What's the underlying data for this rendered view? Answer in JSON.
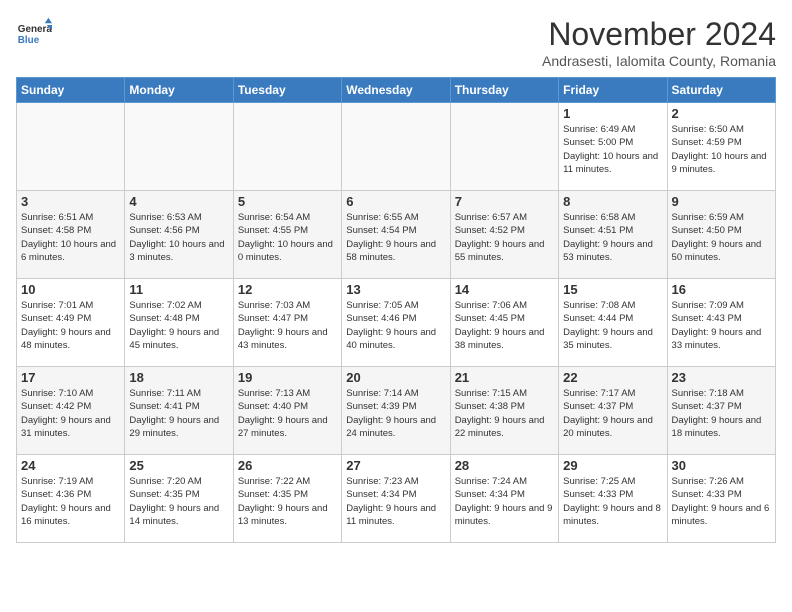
{
  "header": {
    "logo_line1": "General",
    "logo_line2": "Blue",
    "month_title": "November 2024",
    "location": "Andrasesti, Ialomita County, Romania"
  },
  "days_of_week": [
    "Sunday",
    "Monday",
    "Tuesday",
    "Wednesday",
    "Thursday",
    "Friday",
    "Saturday"
  ],
  "weeks": [
    [
      {
        "day": "",
        "info": "",
        "empty": true
      },
      {
        "day": "",
        "info": "",
        "empty": true
      },
      {
        "day": "",
        "info": "",
        "empty": true
      },
      {
        "day": "",
        "info": "",
        "empty": true
      },
      {
        "day": "",
        "info": "",
        "empty": true
      },
      {
        "day": "1",
        "info": "Sunrise: 6:49 AM\nSunset: 5:00 PM\nDaylight: 10 hours and 11 minutes."
      },
      {
        "day": "2",
        "info": "Sunrise: 6:50 AM\nSunset: 4:59 PM\nDaylight: 10 hours and 9 minutes."
      }
    ],
    [
      {
        "day": "3",
        "info": "Sunrise: 6:51 AM\nSunset: 4:58 PM\nDaylight: 10 hours and 6 minutes."
      },
      {
        "day": "4",
        "info": "Sunrise: 6:53 AM\nSunset: 4:56 PM\nDaylight: 10 hours and 3 minutes."
      },
      {
        "day": "5",
        "info": "Sunrise: 6:54 AM\nSunset: 4:55 PM\nDaylight: 10 hours and 0 minutes."
      },
      {
        "day": "6",
        "info": "Sunrise: 6:55 AM\nSunset: 4:54 PM\nDaylight: 9 hours and 58 minutes."
      },
      {
        "day": "7",
        "info": "Sunrise: 6:57 AM\nSunset: 4:52 PM\nDaylight: 9 hours and 55 minutes."
      },
      {
        "day": "8",
        "info": "Sunrise: 6:58 AM\nSunset: 4:51 PM\nDaylight: 9 hours and 53 minutes."
      },
      {
        "day": "9",
        "info": "Sunrise: 6:59 AM\nSunset: 4:50 PM\nDaylight: 9 hours and 50 minutes."
      }
    ],
    [
      {
        "day": "10",
        "info": "Sunrise: 7:01 AM\nSunset: 4:49 PM\nDaylight: 9 hours and 48 minutes."
      },
      {
        "day": "11",
        "info": "Sunrise: 7:02 AM\nSunset: 4:48 PM\nDaylight: 9 hours and 45 minutes."
      },
      {
        "day": "12",
        "info": "Sunrise: 7:03 AM\nSunset: 4:47 PM\nDaylight: 9 hours and 43 minutes."
      },
      {
        "day": "13",
        "info": "Sunrise: 7:05 AM\nSunset: 4:46 PM\nDaylight: 9 hours and 40 minutes."
      },
      {
        "day": "14",
        "info": "Sunrise: 7:06 AM\nSunset: 4:45 PM\nDaylight: 9 hours and 38 minutes."
      },
      {
        "day": "15",
        "info": "Sunrise: 7:08 AM\nSunset: 4:44 PM\nDaylight: 9 hours and 35 minutes."
      },
      {
        "day": "16",
        "info": "Sunrise: 7:09 AM\nSunset: 4:43 PM\nDaylight: 9 hours and 33 minutes."
      }
    ],
    [
      {
        "day": "17",
        "info": "Sunrise: 7:10 AM\nSunset: 4:42 PM\nDaylight: 9 hours and 31 minutes."
      },
      {
        "day": "18",
        "info": "Sunrise: 7:11 AM\nSunset: 4:41 PM\nDaylight: 9 hours and 29 minutes."
      },
      {
        "day": "19",
        "info": "Sunrise: 7:13 AM\nSunset: 4:40 PM\nDaylight: 9 hours and 27 minutes."
      },
      {
        "day": "20",
        "info": "Sunrise: 7:14 AM\nSunset: 4:39 PM\nDaylight: 9 hours and 24 minutes."
      },
      {
        "day": "21",
        "info": "Sunrise: 7:15 AM\nSunset: 4:38 PM\nDaylight: 9 hours and 22 minutes."
      },
      {
        "day": "22",
        "info": "Sunrise: 7:17 AM\nSunset: 4:37 PM\nDaylight: 9 hours and 20 minutes."
      },
      {
        "day": "23",
        "info": "Sunrise: 7:18 AM\nSunset: 4:37 PM\nDaylight: 9 hours and 18 minutes."
      }
    ],
    [
      {
        "day": "24",
        "info": "Sunrise: 7:19 AM\nSunset: 4:36 PM\nDaylight: 9 hours and 16 minutes."
      },
      {
        "day": "25",
        "info": "Sunrise: 7:20 AM\nSunset: 4:35 PM\nDaylight: 9 hours and 14 minutes."
      },
      {
        "day": "26",
        "info": "Sunrise: 7:22 AM\nSunset: 4:35 PM\nDaylight: 9 hours and 13 minutes."
      },
      {
        "day": "27",
        "info": "Sunrise: 7:23 AM\nSunset: 4:34 PM\nDaylight: 9 hours and 11 minutes."
      },
      {
        "day": "28",
        "info": "Sunrise: 7:24 AM\nSunset: 4:34 PM\nDaylight: 9 hours and 9 minutes."
      },
      {
        "day": "29",
        "info": "Sunrise: 7:25 AM\nSunset: 4:33 PM\nDaylight: 9 hours and 8 minutes."
      },
      {
        "day": "30",
        "info": "Sunrise: 7:26 AM\nSunset: 4:33 PM\nDaylight: 9 hours and 6 minutes."
      }
    ]
  ]
}
